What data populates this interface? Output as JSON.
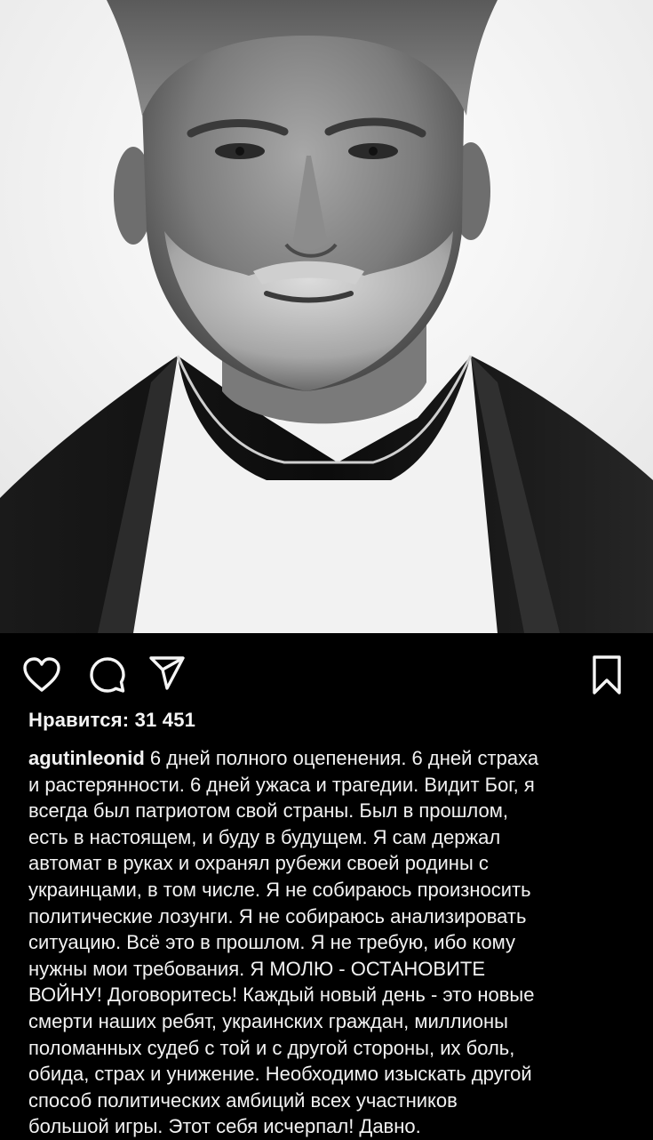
{
  "post": {
    "likes_label": "Нравится:",
    "likes_count": "31 451",
    "username": "agutinleonid",
    "caption_lines": [
      " 6 дней полного оцепенения. 6 дней страха",
      "и растерянности. 6 дней ужаса и трагедии. Видит Бог, я",
      "всегда был патриотом свой страны. Был в прошлом,",
      "есть в настоящем, и буду в будущем. Я сам держал",
      "автомат в руках и охранял рубежи своей родины с",
      "украинцами, в том числе. Я не собираюсь произносить",
      "политические лозунги. Я не собираюсь анализировать",
      "ситуацию. Всё это в прошлом. Я не требую, ибо кому",
      "нужны мои требования. Я МОЛЮ - ОСТАНОВИТЕ",
      "ВОЙНУ! Договоритесь! Каждый новый день - это новые",
      "смерти наших ребят, украинских граждан, миллионы",
      "поломанных судеб с той и с другой стороны,  их боль,",
      "обида, страх и унижение. Необходимо изыскать другой",
      "способ политических амбиций всех участников",
      "большой игры. Этот себя исчерпал! Давно."
    ]
  },
  "icons": {
    "like": "heart-icon",
    "comment": "comment-icon",
    "share": "paper-plane-icon",
    "save": "bookmark-icon"
  },
  "colors": {
    "background": "#000000",
    "text": "#f5f5f5"
  }
}
